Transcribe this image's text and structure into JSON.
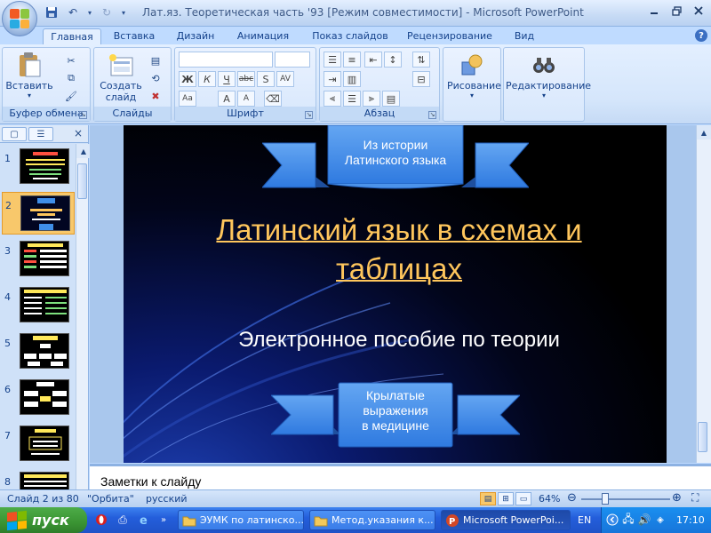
{
  "window": {
    "title": "Лат.яз. Теоретическая часть '93 [Режим совместимости] - Microsoft PowerPoint"
  },
  "ribbon_tabs": [
    {
      "label": "Главная",
      "active": true
    },
    {
      "label": "Вставка"
    },
    {
      "label": "Дизайн"
    },
    {
      "label": "Анимация"
    },
    {
      "label": "Показ слайдов"
    },
    {
      "label": "Рецензирование"
    },
    {
      "label": "Вид"
    }
  ],
  "ribbon": {
    "paste_label": "Вставить",
    "new_slide_label_1": "Создать",
    "new_slide_label_2": "слайд",
    "drawing_label": "Рисование",
    "editing_label": "Редактирование",
    "groups": {
      "clipboard": "Буфер обмена",
      "slides": "Слайды",
      "font": "Шрифт",
      "paragraph": "Абзац"
    },
    "font_buttons": {
      "bold": "Ж",
      "italic": "К",
      "underline": "Ч",
      "strike": "abc",
      "shadow": "S",
      "spacing": "AV",
      "case": "Aa",
      "grow": "A",
      "shrink": "A"
    }
  },
  "left_pane": {
    "selected_slide": 2,
    "thumbnails": [
      {
        "num": "1"
      },
      {
        "num": "2"
      },
      {
        "num": "3"
      },
      {
        "num": "4"
      },
      {
        "num": "5"
      },
      {
        "num": "6"
      },
      {
        "num": "7"
      },
      {
        "num": "8"
      }
    ]
  },
  "slide": {
    "banner_top_line1": "Из истории",
    "banner_top_line2": "Латинского языка",
    "title_line1": "Латинский язык в схемах и",
    "title_line2": "таблицах",
    "subtitle": "Электронное пособие по теории",
    "banner_bottom_line1": "Крылатые",
    "banner_bottom_line2": "выражения",
    "banner_bottom_line3": "в медицине"
  },
  "notes": {
    "placeholder": "Заметки к слайду"
  },
  "status_bar": {
    "slide_info": "Слайд 2 из 80",
    "theme": "\"Орбита\"",
    "language": "русский",
    "zoom": "64%"
  },
  "taskbar": {
    "start_label": "пуск",
    "tasks": [
      {
        "label": "ЭУМК по латинско..."
      },
      {
        "label": "Метод.указания к..."
      },
      {
        "label": "Microsoft PowerPoi...",
        "active": true
      }
    ],
    "lang": "EN",
    "clock": "17:10"
  },
  "colors": {
    "banner_blue": "#3f8ee8",
    "title_gold": "#ffc65c"
  }
}
